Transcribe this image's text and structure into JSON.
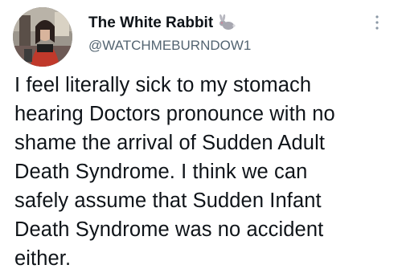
{
  "author": {
    "display_name": "The White Rabbit",
    "handle": "@WATCHMEBURNDOW1",
    "badge_icon": "rabbit-icon",
    "avatar_icon": "profile-photo"
  },
  "menu": {
    "icon": "more-vertical-icon"
  },
  "tweet": {
    "text": "I feel literally sick to my stomach\nhearing Doctors pronounce with no\nshame the arrival of Sudden Adult\nDeath Syndrome. I think we can\nsafely assume that Sudden Infant\nDeath Syndrome was no accident\neither."
  },
  "colors": {
    "text": "#0f1419",
    "secondary": "#536471",
    "background": "#ffffff"
  }
}
